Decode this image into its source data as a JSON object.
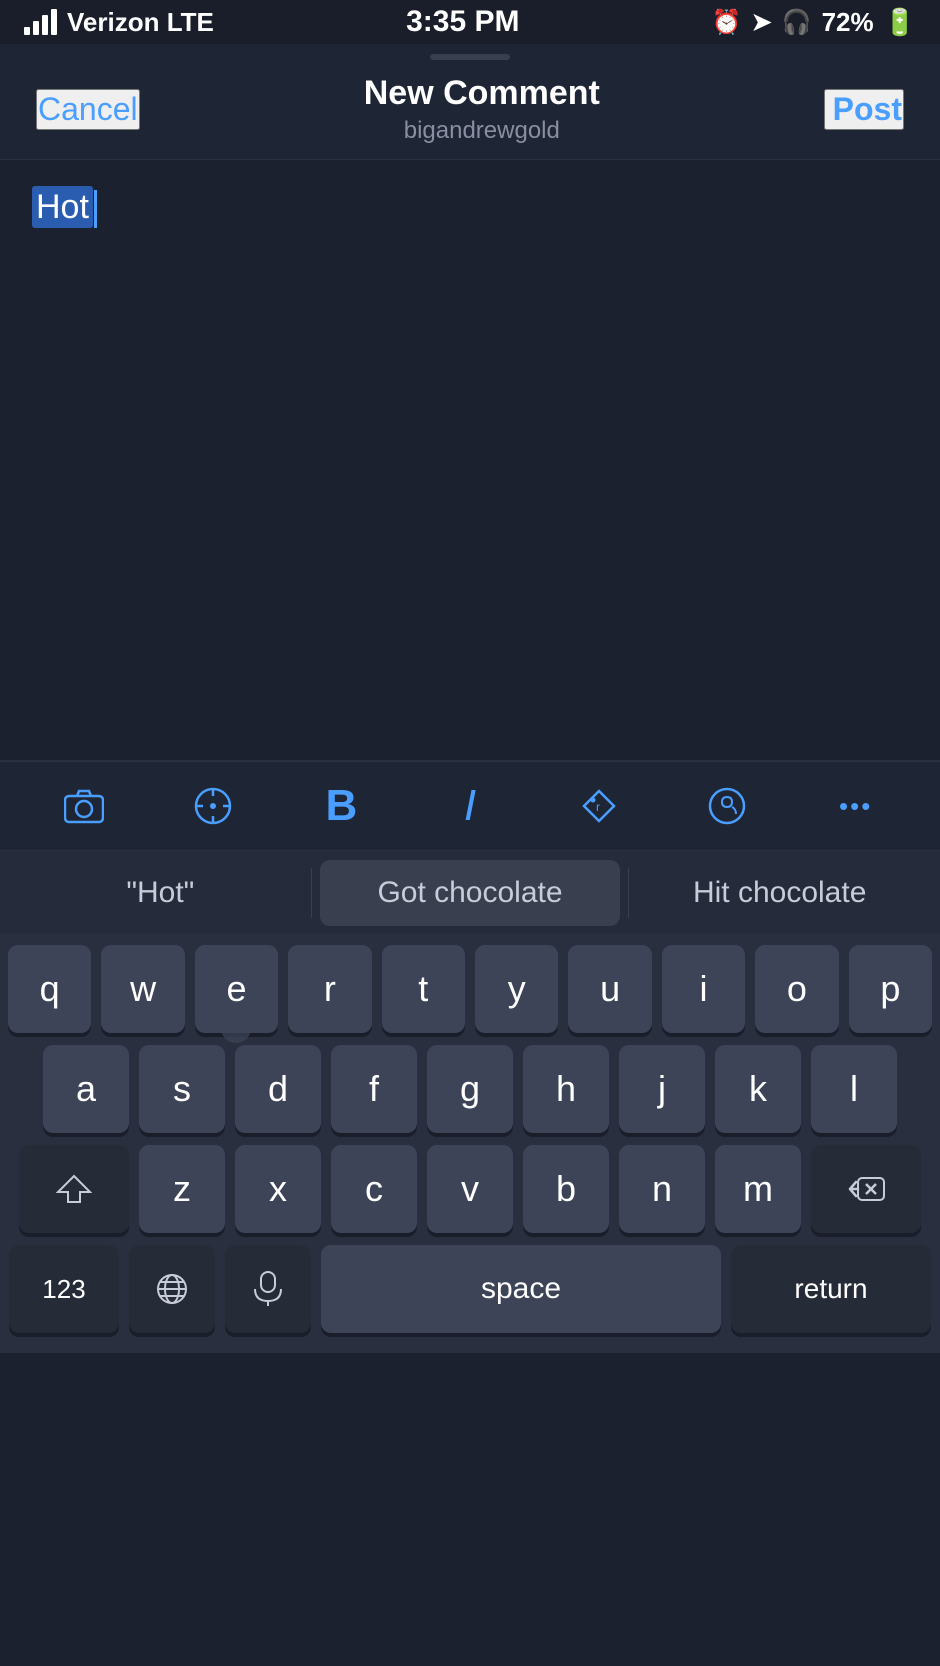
{
  "statusBar": {
    "carrier": "Verizon LTE",
    "time": "3:35 PM",
    "batteryPercent": "72%"
  },
  "navBar": {
    "cancelLabel": "Cancel",
    "title": "New Comment",
    "username": "bigandrewgold",
    "postLabel": "Post"
  },
  "commentArea": {
    "text": "Hot"
  },
  "autocomplete": {
    "left": "\"Hot\"",
    "center": "Got chocolate",
    "right": "Hit chocolate"
  },
  "toolbar": {
    "cameraIcon": "📷",
    "compassIcon": "⊘",
    "boldLabel": "B",
    "italicLabel": "I",
    "tagLabel": "⬡",
    "mentionLabel": "Ω",
    "moreLabel": "•••"
  },
  "keyboard": {
    "row1": [
      "q",
      "w",
      "e",
      "r",
      "t",
      "y",
      "u",
      "i",
      "o",
      "p"
    ],
    "row2": [
      "a",
      "s",
      "d",
      "f",
      "g",
      "h",
      "j",
      "k",
      "l"
    ],
    "row3": [
      "z",
      "x",
      "c",
      "v",
      "b",
      "n",
      "m"
    ],
    "bottomLeft": "123",
    "space": "space",
    "returnLabel": "return"
  }
}
